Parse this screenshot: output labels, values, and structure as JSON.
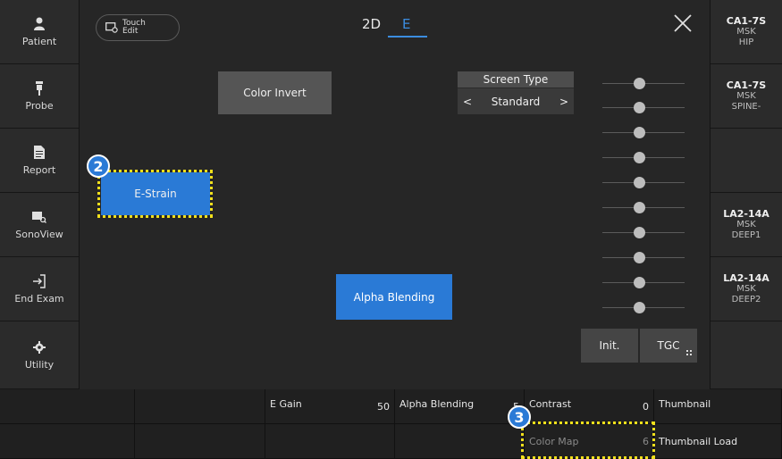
{
  "left_sidebar": [
    {
      "label": "Patient",
      "icon": "person-icon"
    },
    {
      "label": "Probe",
      "icon": "probe-icon"
    },
    {
      "label": "Report",
      "icon": "document-icon"
    },
    {
      "label": "SonoView",
      "icon": "sonoview-icon"
    },
    {
      "label": "End Exam",
      "icon": "exit-icon"
    },
    {
      "label": "Utility",
      "icon": "gear-icon"
    }
  ],
  "right_sidebar": [
    {
      "line1": "CA1-7S",
      "line2": "MSK",
      "line3": "HIP"
    },
    {
      "line1": "CA1-7S",
      "line2": "MSK",
      "line3": "SPINE-"
    },
    {
      "line1": "",
      "line2": "",
      "line3": ""
    },
    {
      "line1": "LA2-14A",
      "line2": "MSK",
      "line3": "DEEP1"
    },
    {
      "line1": "LA2-14A",
      "line2": "MSK",
      "line3": "DEEP2"
    },
    {
      "line1": "",
      "line2": "",
      "line3": ""
    }
  ],
  "header": {
    "touch_edit_line1": "Touch",
    "touch_edit_line2": "Edit",
    "tab_2d": "2D",
    "tab_e": "E"
  },
  "buttons": {
    "color_invert": "Color Invert",
    "e_strain": "E-Strain",
    "alpha_blending": "Alpha Blending",
    "init": "Init.",
    "tgc": "TGC"
  },
  "screen_type": {
    "title": "Screen Type",
    "value": "Standard",
    "prev": "<",
    "next": ">"
  },
  "annotations": {
    "badge_2": "2",
    "badge_3": "3"
  },
  "bottom": {
    "row1": [
      {
        "label": "",
        "value": ""
      },
      {
        "label": "",
        "value": ""
      },
      {
        "label": "E Gain",
        "value": "50"
      },
      {
        "label": "Alpha Blending",
        "value": "5"
      },
      {
        "label": "Contrast",
        "value": "0"
      },
      {
        "label": "Thumbnail",
        "value": ""
      }
    ],
    "row2": [
      {
        "label": "",
        "value": ""
      },
      {
        "label": "",
        "value": ""
      },
      {
        "label": "",
        "value": ""
      },
      {
        "label": "",
        "value": ""
      },
      {
        "label": "Color Map",
        "value": "6"
      },
      {
        "label": "Thumbnail Load",
        "value": ""
      }
    ]
  },
  "colors": {
    "accent_blue": "#2a7ad6",
    "highlight_yellow": "#f2e01b",
    "panel_bg": "#262626"
  }
}
